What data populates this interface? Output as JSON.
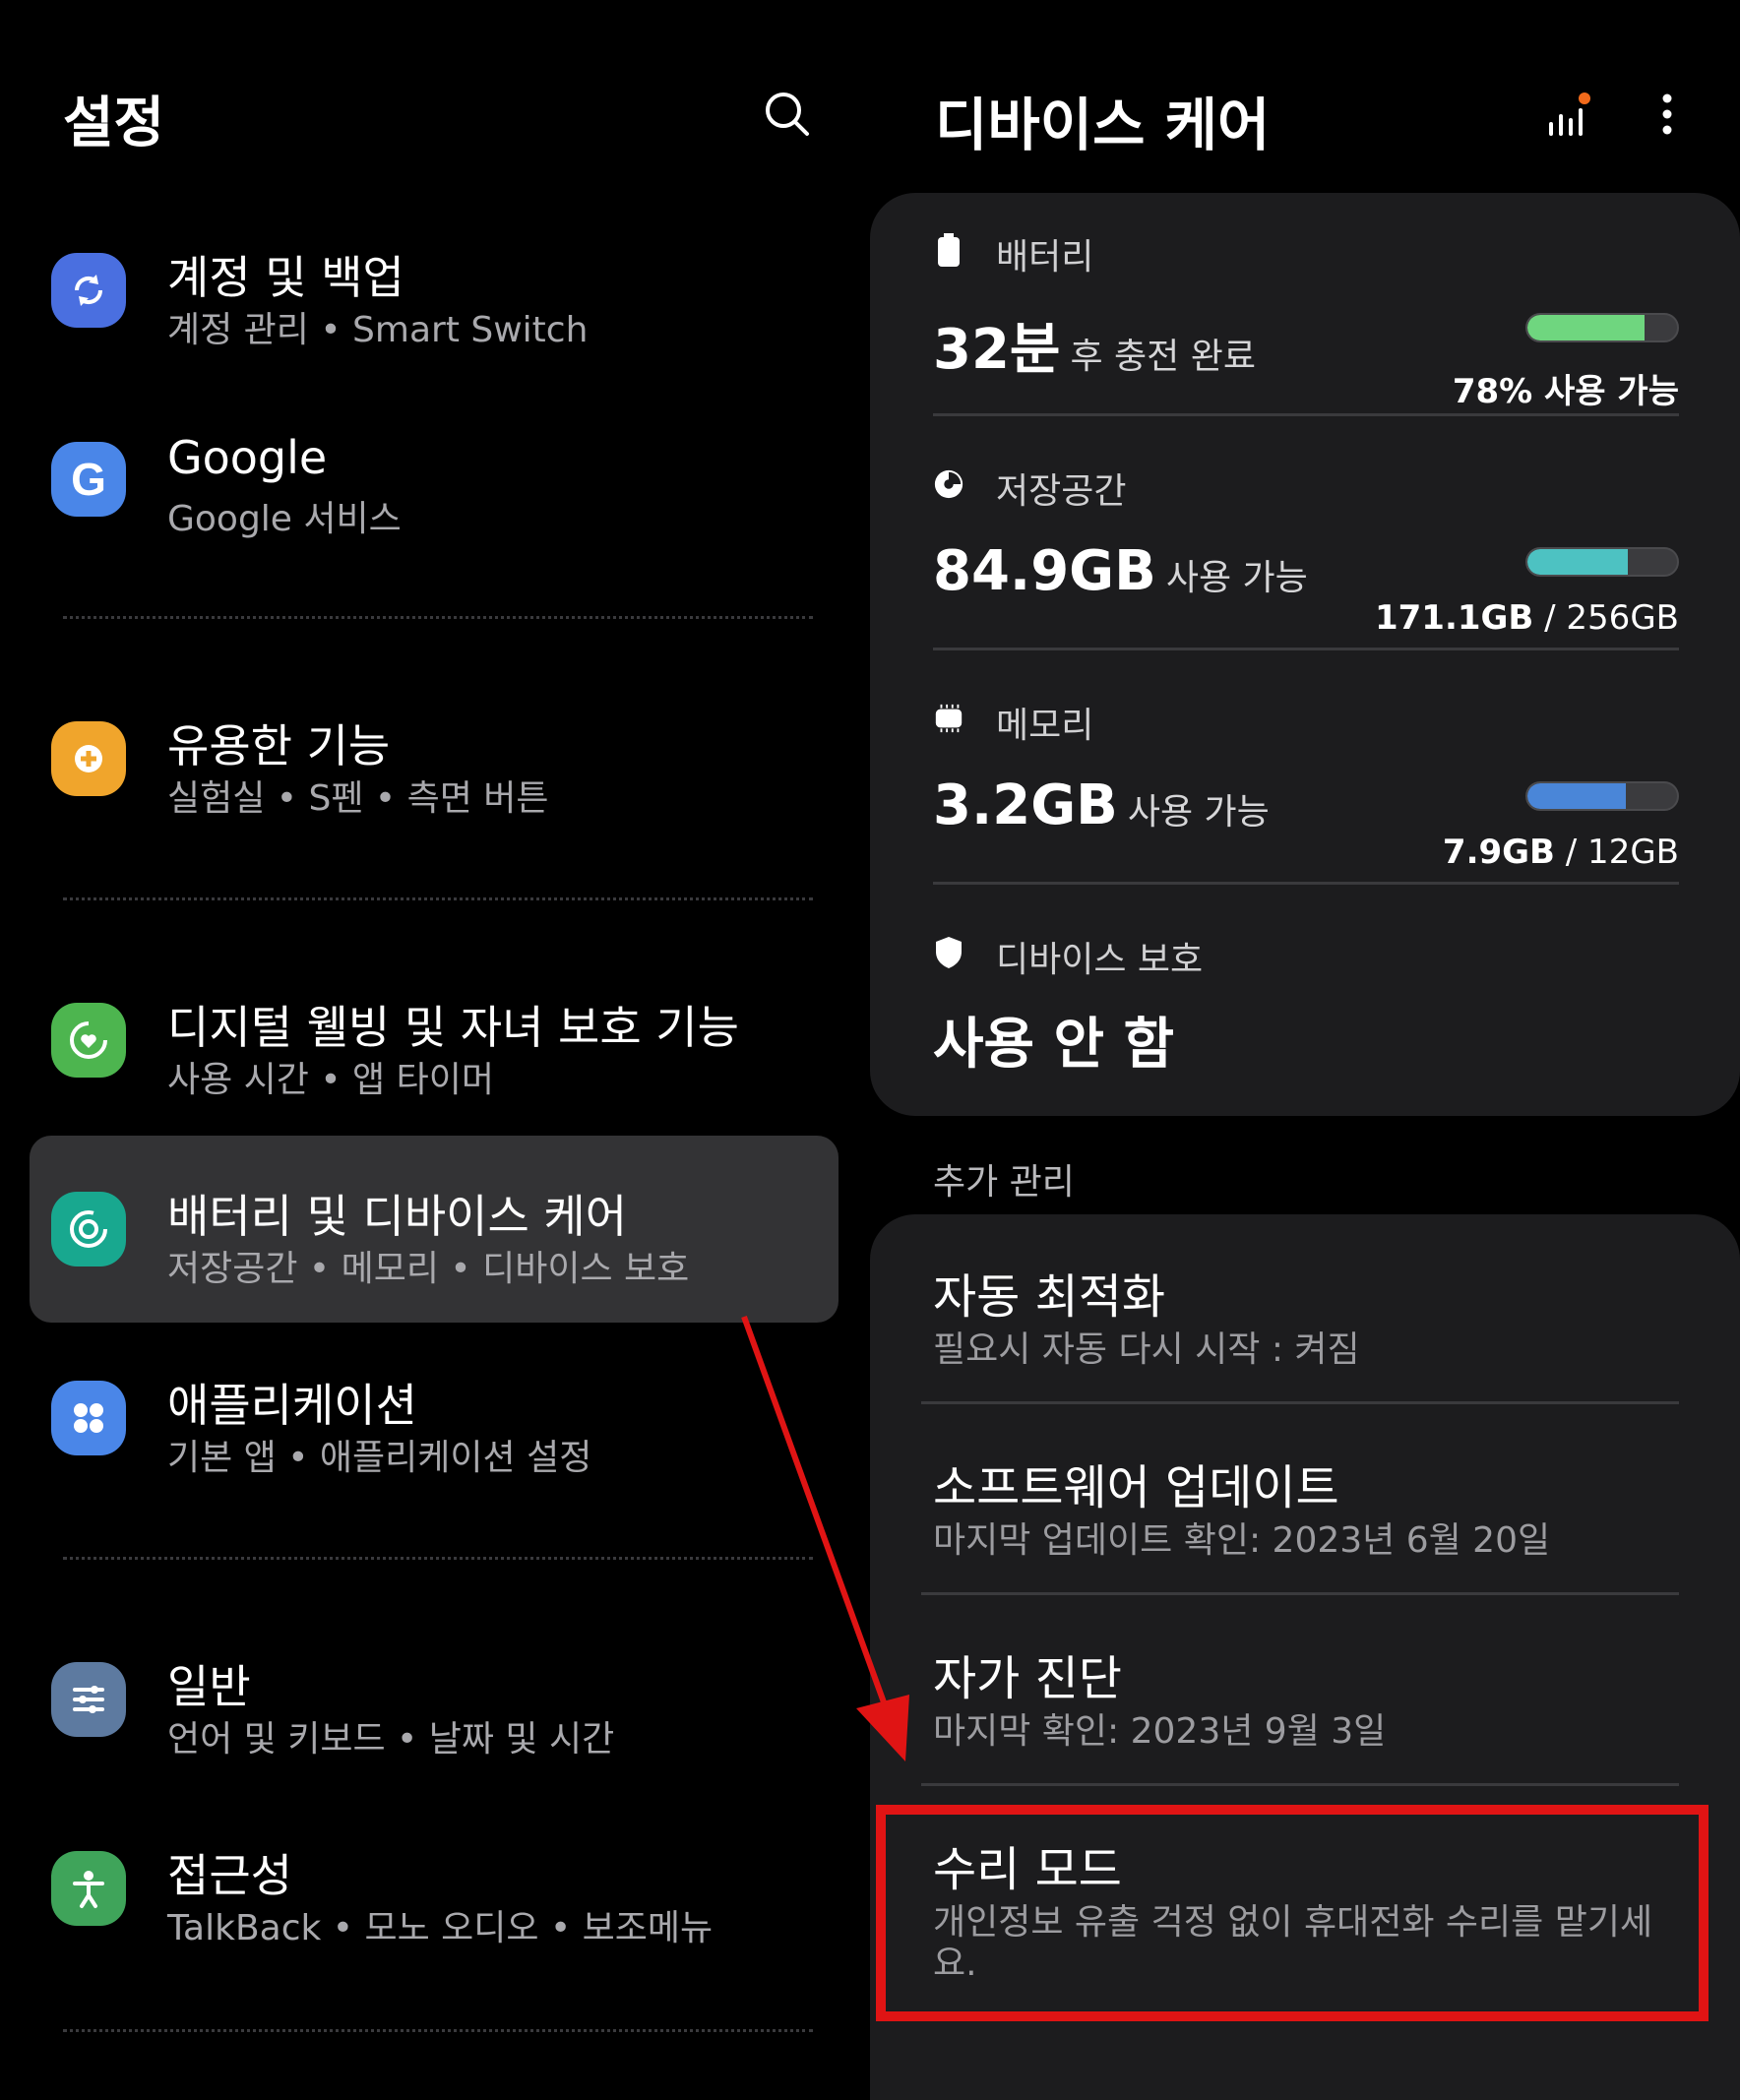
{
  "left": {
    "title": "설정",
    "items": [
      {
        "title": "계정 및 백업",
        "subtitle": "계정 관리 • Smart Switch",
        "icon": "sync-icon",
        "color": "#4a6fe0"
      },
      {
        "title": "Google",
        "subtitle": "Google 서비스",
        "icon": "google-icon",
        "color": "#4a86e8"
      },
      {
        "title": "유용한 기능",
        "subtitle": "실험실 • S펜 • 측면 버튼",
        "icon": "puzzle-icon",
        "color": "#f0a52c"
      },
      {
        "title": "디지털 웰빙 및 자녀 보호 기능",
        "subtitle": "사용 시간 • 앱 타이머",
        "icon": "wellbeing-icon",
        "color": "#4db54f"
      },
      {
        "title": "배터리 및 디바이스 케어",
        "subtitle": "저장공간 • 메모리 • 디바이스 보호",
        "icon": "device-care-icon",
        "color": "#18a88f"
      },
      {
        "title": "애플리케이션",
        "subtitle": "기본 앱 • 애플리케이션 설정",
        "icon": "apps-icon",
        "color": "#4a86e8"
      },
      {
        "title": "일반",
        "subtitle": "언어 및 키보드 • 날짜 및 시간",
        "icon": "sliders-icon",
        "color": "#5d7aa0"
      },
      {
        "title": "접근성",
        "subtitle": "TalkBack • 모노 오디오 • 보조메뉴",
        "icon": "accessibility-icon",
        "color": "#3fa45a"
      }
    ]
  },
  "right": {
    "title": "디바이스 케어",
    "battery": {
      "label": "배터리",
      "value": "32분",
      "suffix": "후 충전 완료",
      "stat": "78% 사용 가능",
      "level": 0.78,
      "color": "#6fd67f"
    },
    "storage": {
      "label": "저장공간",
      "value": "84.9GB",
      "suffix": "사용 가능",
      "stat_used": "171.1GB",
      "stat_total": "/ 256GB",
      "level": 0.67,
      "color": "#4dc2c2"
    },
    "memory": {
      "label": "메모리",
      "value": "3.2GB",
      "suffix": "사용 가능",
      "stat_used": "7.9GB",
      "stat_total": "/ 12GB",
      "level": 0.66,
      "color": "#4a86d8"
    },
    "protection": {
      "label": "디바이스 보호",
      "value": "사용 안 함"
    },
    "extra_heading": "추가 관리",
    "extra": [
      {
        "title": "자동 최적화",
        "subtitle": "필요시 자동 다시 시작 : 켜짐"
      },
      {
        "title": "소프트웨어 업데이트",
        "subtitle": "마지막 업데이트 확인: 2023년 6월 20일"
      },
      {
        "title": "자가 진단",
        "subtitle": "마지막 확인: 2023년 9월 3일"
      },
      {
        "title": "수리 모드",
        "subtitle": "개인정보 유출 걱정 없이 휴대전화 수리를 맡기세",
        "subtitle2": "요."
      }
    ]
  },
  "colors": {
    "highlight": "#e01414",
    "notification_dot": "#f26a1b"
  }
}
